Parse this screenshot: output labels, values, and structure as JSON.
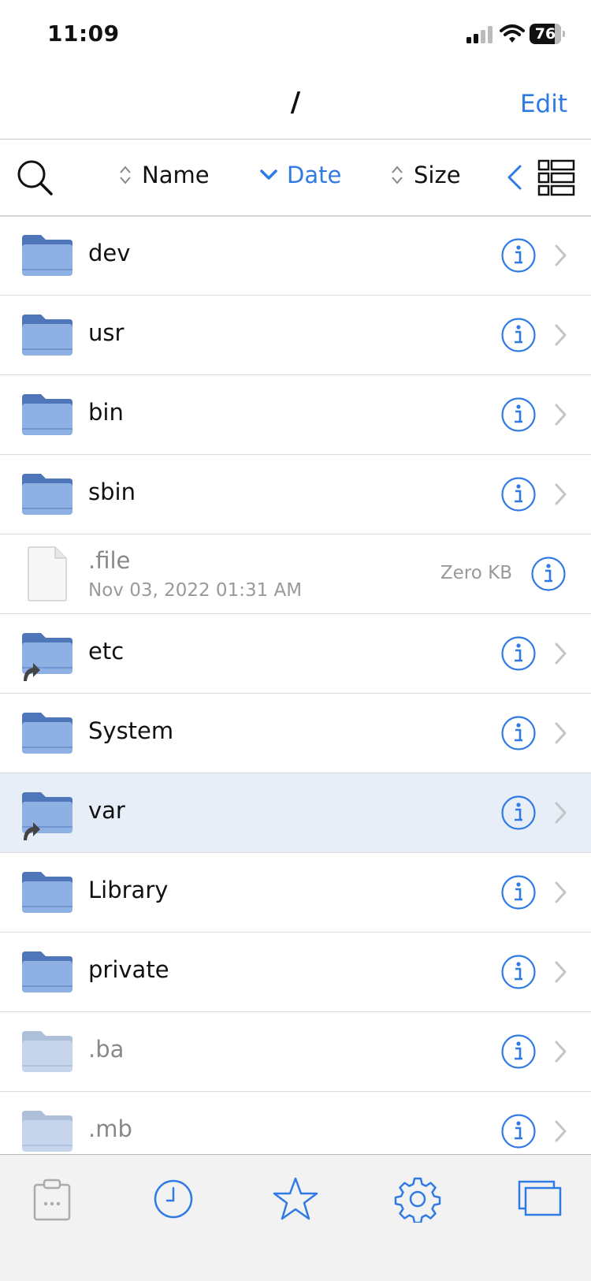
{
  "status_bar": {
    "time": "11:09",
    "battery_level": "76"
  },
  "nav": {
    "title": "/",
    "edit_label": "Edit"
  },
  "toolbar": {
    "sort_name_label": "Name",
    "sort_date_label": "Date",
    "sort_size_label": "Size",
    "active_sort": "Date"
  },
  "colors": {
    "accent": "#2f7ae5",
    "folder": "#8fb0e3",
    "folder_dark": "#4f76b8",
    "selected_row": "#e8eef8"
  },
  "items": [
    {
      "name": "dev",
      "type": "folder"
    },
    {
      "name": "usr",
      "type": "folder"
    },
    {
      "name": "bin",
      "type": "folder"
    },
    {
      "name": "sbin",
      "type": "folder"
    },
    {
      "name": ".file",
      "type": "file",
      "date": "Nov 03, 2022 01:31 AM",
      "size": "Zero KB"
    },
    {
      "name": "etc",
      "type": "alias-folder"
    },
    {
      "name": "System",
      "type": "folder"
    },
    {
      "name": "var",
      "type": "alias-folder",
      "selected": true
    },
    {
      "name": "Library",
      "type": "folder"
    },
    {
      "name": "private",
      "type": "folder"
    },
    {
      "name": ".ba",
      "type": "hidden-folder"
    },
    {
      "name": ".mb",
      "type": "hidden-folder"
    }
  ],
  "tabs": [
    "clipboard-icon",
    "clock-icon",
    "star-icon",
    "gear-icon",
    "windows-icon"
  ]
}
